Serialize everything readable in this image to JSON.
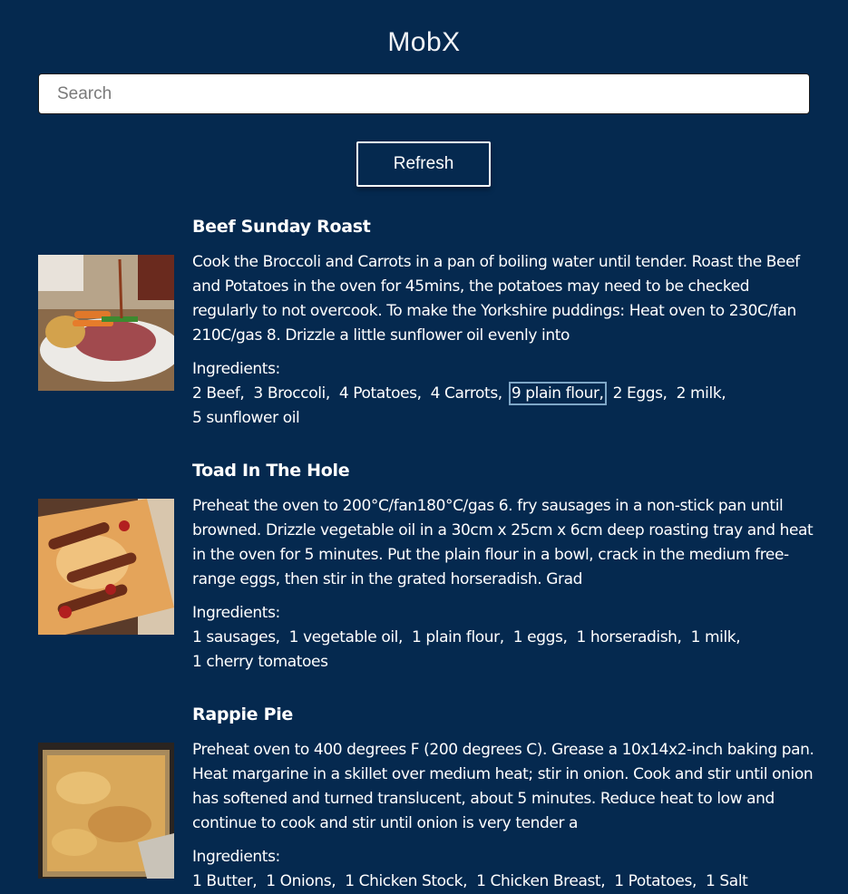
{
  "app": {
    "title": "MobX"
  },
  "search": {
    "placeholder": "Search",
    "value": ""
  },
  "toolbar": {
    "refresh_label": "Refresh"
  },
  "ingredients_label": "Ingredients:",
  "recipes": [
    {
      "title": "Beef Sunday Roast",
      "description": "Cook the Broccoli and Carrots in a pan of boiling water until tender.  Roast the Beef and Potatoes in the oven for 45mins, the potatoes may need to be checked regularly to not overcook.  To make the Yorkshire puddings: Heat oven to 230C/fan 210C/gas 8. Drizzle a little sunflower oil evenly into",
      "ingredients": [
        "2 Beef,",
        "3 Broccoli,",
        "4 Potatoes,",
        "4 Carrots,",
        "9 plain flour,",
        "2 Eggs,",
        "2 milk,",
        "5 sunflower oil"
      ],
      "image_icon": "roast-beef-photo"
    },
    {
      "title": "Toad In The Hole",
      "description": "Preheat the oven to 200°C/fan180°C/gas 6. fry sausages in a non-stick pan until browned. Drizzle vegetable oil in a 30cm x 25cm x 6cm deep roasting tray and heat in the oven for 5 minutes. Put the plain flour in a bowl, crack in the medium free-range eggs, then stir in the grated horseradish. Grad",
      "ingredients": [
        "1 sausages,",
        "1 vegetable oil,",
        "1 plain flour,",
        "1 eggs,",
        "1 horseradish,",
        "1 milk,",
        "1 cherry tomatoes"
      ],
      "image_icon": "toad-in-the-hole-photo"
    },
    {
      "title": "Rappie Pie",
      "description": "Preheat oven to 400 degrees F (200 degrees C). Grease a 10x14x2-inch baking pan. Heat margarine in a skillet over medium heat; stir in onion. Cook and stir until onion has softened and turned translucent, about 5 minutes. Reduce heat to low and continue to cook and stir until onion is very tender a",
      "ingredients": [
        "1 Butter,",
        "1 Onions,",
        "1 Chicken Stock,",
        "1 Chicken Breast,",
        "1 Potatoes,",
        "1 Salt"
      ],
      "image_icon": "rappie-pie-photo"
    }
  ],
  "colors": {
    "background": "#05294f",
    "focus_outline": "#7fa7c7"
  }
}
